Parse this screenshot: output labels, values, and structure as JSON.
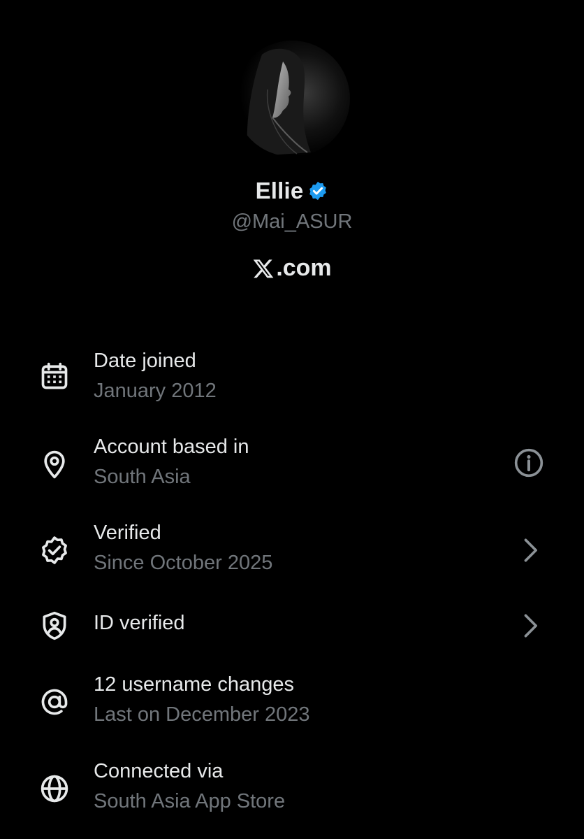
{
  "profile": {
    "display_name": "Ellie",
    "handle": "@Mai_ASUR",
    "site": ".com",
    "site_logo_icon": "x-logo-icon",
    "verified_badge_color": "#1d9bf0"
  },
  "rows": [
    {
      "icon": "calendar-icon",
      "title": "Date joined",
      "subtitle": "January 2012"
    },
    {
      "icon": "location-pin-icon",
      "title": "Account based in",
      "subtitle": "South Asia",
      "trailing": "info-icon"
    },
    {
      "icon": "verified-badge-icon",
      "title": "Verified",
      "subtitle": "Since October 2025",
      "trailing": "chevron-right-icon"
    },
    {
      "icon": "shield-person-icon",
      "title": "ID verified",
      "trailing": "chevron-right-icon"
    },
    {
      "icon": "at-sign-icon",
      "title": "12 username changes",
      "subtitle": "Last on December 2023"
    },
    {
      "icon": "globe-icon",
      "title": "Connected via",
      "subtitle": "South Asia App Store"
    }
  ],
  "colors": {
    "background": "#000000",
    "primary_text": "#e7e9ea",
    "secondary_text": "#71767b",
    "accent": "#1d9bf0"
  }
}
